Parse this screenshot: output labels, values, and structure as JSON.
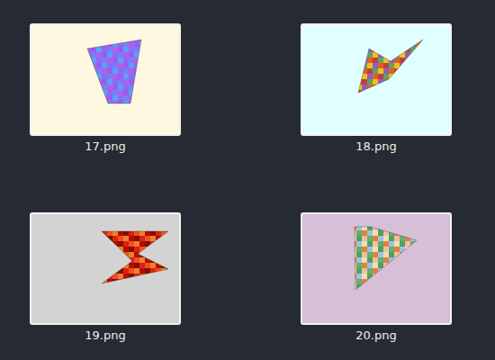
{
  "files": [
    {
      "label": "17.png",
      "selected": false,
      "color": "#fff8e1"
    },
    {
      "label": "18.png",
      "selected": false,
      "color": "#e0ffff"
    },
    {
      "label": "19.png",
      "selected": false,
      "color": "#d3d3d3"
    },
    {
      "label": "20.png",
      "selected": false,
      "color": "#d8bfd8"
    }
  ]
}
